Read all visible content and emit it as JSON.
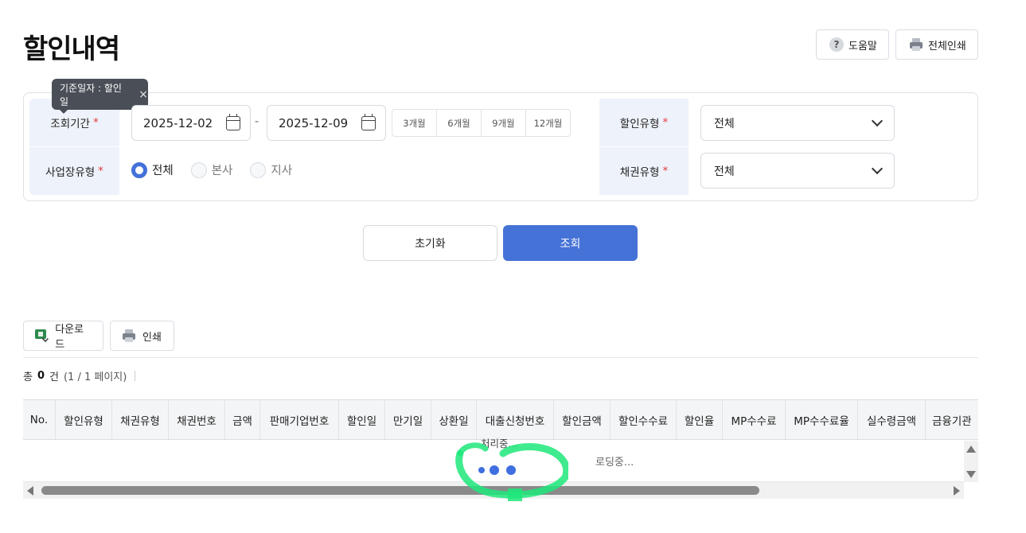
{
  "page": {
    "title": "할인내역"
  },
  "header_buttons": {
    "help": "도움말",
    "print_all": "전체인쇄",
    "help_glyph": "?"
  },
  "tooltip": {
    "text": "기준일자 : 할인일",
    "close_glyph": "×"
  },
  "filters": {
    "period_label": "조회기간",
    "required_mark": "*",
    "date_from": "2025-12-02",
    "date_to": "2025-12-09",
    "date_separator": "-",
    "quick_periods": [
      "3개월",
      "6개월",
      "9개월",
      "12개월"
    ],
    "biz_type_label": "사업장유형",
    "biz_type_options": [
      "전체",
      "본사",
      "지사"
    ],
    "biz_type_selected": "전체",
    "discount_type_label": "할인유형",
    "discount_type_value": "전체",
    "bond_type_label": "채권유형",
    "bond_type_value": "전체"
  },
  "actions": {
    "reset": "초기화",
    "search": "조회"
  },
  "toolbar": {
    "download": "다운로드",
    "print": "인쇄"
  },
  "summary": {
    "prefix": "총",
    "count": "0",
    "unit": "건",
    "pages": "(1 / 1 페이지)"
  },
  "grid": {
    "columns": [
      "No.",
      "할인유형",
      "채권유형",
      "채권번호",
      "금액",
      "판매기업번호",
      "할인일",
      "만기일",
      "상환일",
      "대출신청번호",
      "할인금액",
      "할인수수료",
      "할인율",
      "MP수수료",
      "MP수수료율",
      "실수령금액",
      "금융기관"
    ],
    "loading_text": "로딩중...",
    "processing_text": "처리중..."
  },
  "colors": {
    "primary": "#4572d6",
    "required": "#e03a3a",
    "label_bg": "#eef2fa",
    "annotation": "#1de87a"
  }
}
